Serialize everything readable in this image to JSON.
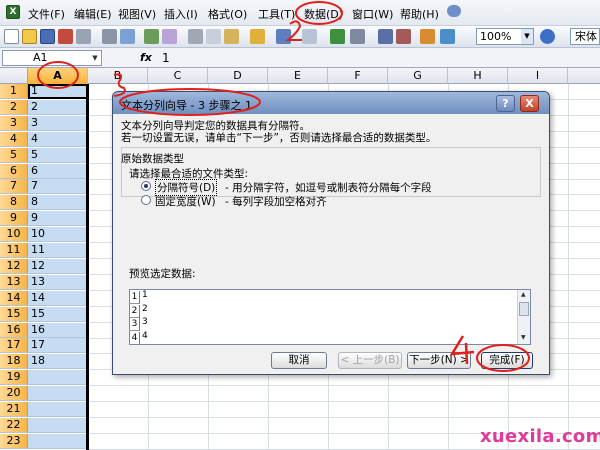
{
  "menu": {
    "items": [
      "文件(F)",
      "编辑(E)",
      "视图(V)",
      "插入(I)",
      "格式(O)",
      "工具(T)",
      "数据(D)",
      "窗口(W)",
      "帮助(H)"
    ],
    "highlighted": "数据(D)"
  },
  "toolbar": {
    "zoom": "100%",
    "font": "宋体"
  },
  "formula_bar": {
    "name_box": "A1",
    "fx_label": "fx",
    "value": "1"
  },
  "sheet": {
    "columns": [
      "A",
      "B",
      "C",
      "D",
      "E",
      "F",
      "G",
      "H",
      "I"
    ],
    "selected_column": "A",
    "rows": [
      "1",
      "2",
      "3",
      "4",
      "5",
      "6",
      "7",
      "8",
      "9",
      "10",
      "11",
      "12",
      "13",
      "14",
      "15",
      "16",
      "17",
      "18",
      "19",
      "20",
      "21",
      "22",
      "23"
    ],
    "column_a_values": [
      "1",
      "2",
      "3",
      "4",
      "5",
      "6",
      "7",
      "8",
      "9",
      "10",
      "11",
      "12",
      "13",
      "14",
      "15",
      "16",
      "17",
      "18"
    ]
  },
  "dialog": {
    "title": "文本分列向导 - 3 步骤之 1",
    "desc_line1": "文本分列向导判定您的数据具有分隔符。",
    "desc_line2": "若一切设置无误，请单击“下一步”，否则请选择最合适的数据类型。",
    "group_label": "原始数据类型",
    "hint": "请选择最合适的文件类型:",
    "options": [
      {
        "name": "分隔符号(D)",
        "desc": "- 用分隔字符，如逗号或制表符分隔每个字段",
        "checked": true
      },
      {
        "name": "固定宽度(W)",
        "desc": "- 每列字段加空格对齐",
        "checked": false
      }
    ],
    "preview_label": "预览选定数据:",
    "preview_rows": [
      {
        "num": "1",
        "value": "1"
      },
      {
        "num": "2",
        "value": "2"
      },
      {
        "num": "3",
        "value": "3"
      },
      {
        "num": "4",
        "value": "4"
      }
    ],
    "buttons": {
      "cancel": "取消",
      "back": "< 上一步(B)",
      "next": "下一步(N) >",
      "finish": "完成(F)"
    },
    "help_glyph": "?",
    "close_glyph": "X"
  },
  "annotations": {
    "step2": "2",
    "step3": "3",
    "step4": "4"
  },
  "watermark": "xuexila.com"
}
